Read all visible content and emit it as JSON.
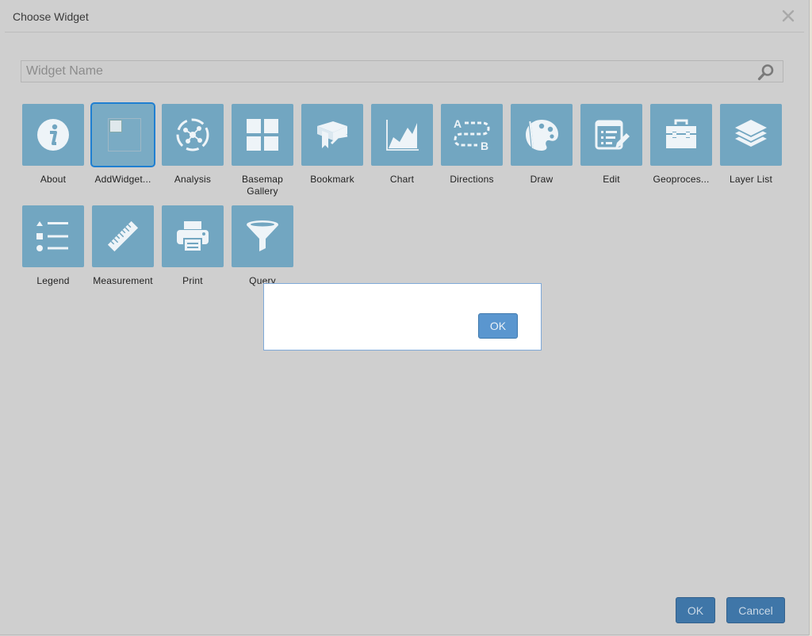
{
  "dialog": {
    "title": "Choose Widget",
    "search": {
      "placeholder": "Widget Name",
      "value": ""
    },
    "ok_label": "OK",
    "cancel_label": "Cancel"
  },
  "widgets": [
    {
      "label": "About",
      "icon": "info-icon"
    },
    {
      "label": "AddWidget...",
      "icon": "broken-image-icon",
      "selected": true
    },
    {
      "label": "Analysis",
      "icon": "analysis-icon"
    },
    {
      "label": "Basemap Gallery",
      "icon": "grid-icon"
    },
    {
      "label": "Bookmark",
      "icon": "bookmark-book-icon"
    },
    {
      "label": "Chart",
      "icon": "area-chart-icon"
    },
    {
      "label": "Directions",
      "icon": "directions-icon"
    },
    {
      "label": "Draw",
      "icon": "palette-icon"
    },
    {
      "label": "Edit",
      "icon": "edit-icon"
    },
    {
      "label": "Geoproces...",
      "icon": "toolbox-icon"
    },
    {
      "label": "Layer List",
      "icon": "layers-icon"
    },
    {
      "label": "Legend",
      "icon": "legend-list-icon"
    },
    {
      "label": "Measurement",
      "icon": "ruler-icon"
    },
    {
      "label": "Print",
      "icon": "printer-icon"
    },
    {
      "label": "Query",
      "icon": "funnel-icon"
    }
  ],
  "popup": {
    "ok_label": "OK"
  },
  "colors": {
    "tile": "#72a6c1",
    "selected_border": "#1f7fd1",
    "button": "#4d8ec8"
  }
}
